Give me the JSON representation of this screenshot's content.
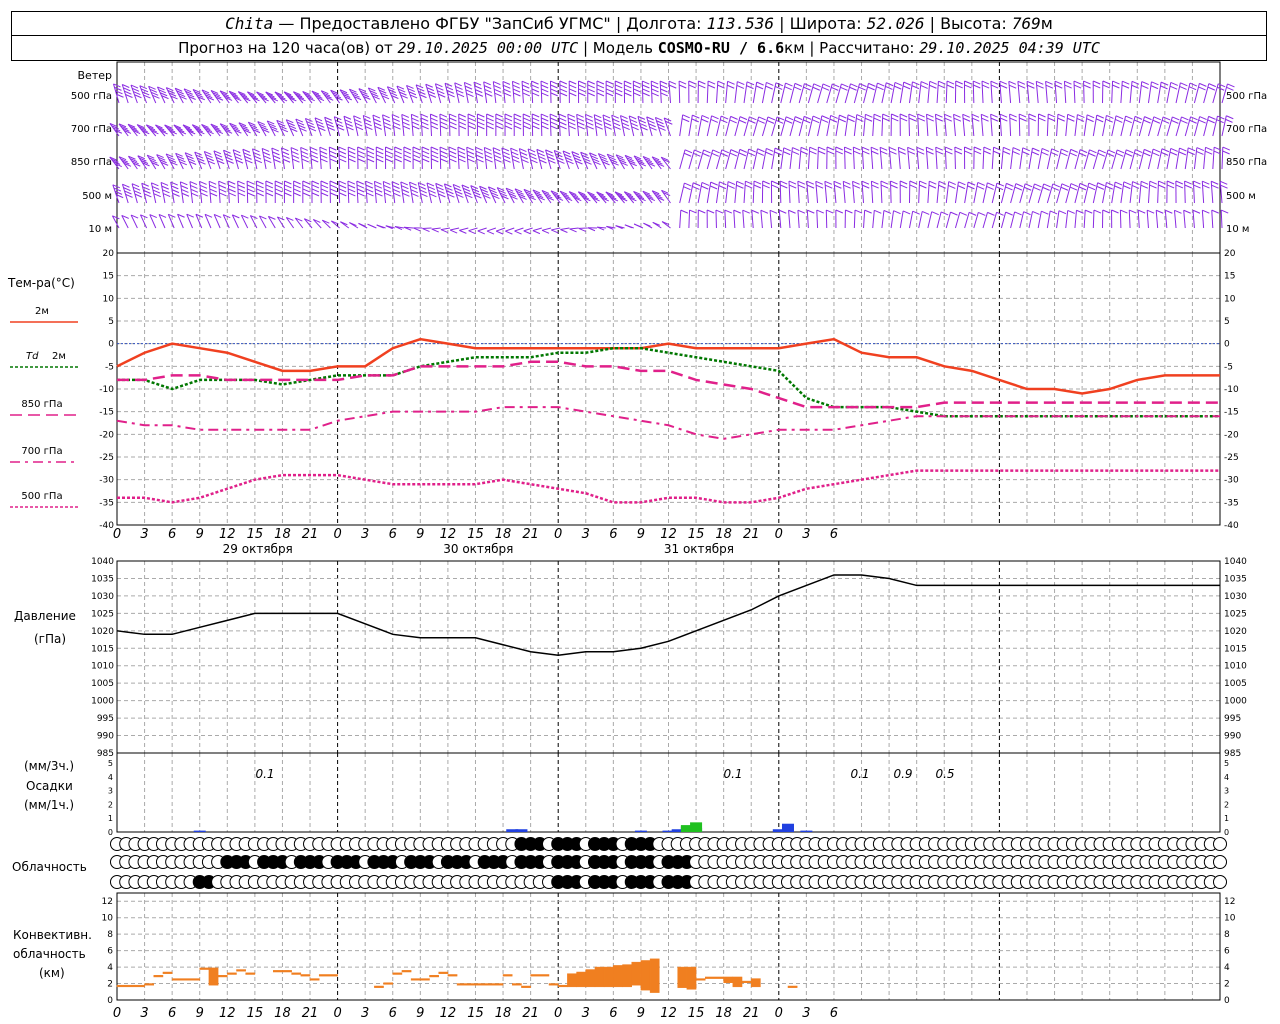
{
  "header": {
    "station": "Chita",
    "provider": "Предоставлено ФГБУ \"ЗапСиб УГМС\"",
    "lon_label": "Долгота:",
    "lon": "113.536",
    "lat_label": "Широта:",
    "lat": "52.026",
    "alt_label": "Высота:",
    "alt": "769",
    "alt_unit": "м",
    "forecast_label": "Прогноз на 120 часа(ов) от",
    "forecast_time": "29.10.2025 00:00 UTC",
    "model_label": "Модель",
    "model": "COSMO-RU / 6.6",
    "model_unit": "км",
    "computed_label": "Рассчитано:",
    "computed_time": "29.10.2025 04:39 UTC"
  },
  "colors": {
    "wind": "#8a2be2",
    "t2m": "#f04020",
    "td2m": "#007700",
    "t850": "#e0208a",
    "t700": "#e0208a",
    "t500": "#e0208a",
    "pressure": "#000000",
    "precip_blue": "#2040e0",
    "precip_green": "#20c020",
    "conv": "#f07f20",
    "zero_line": "#3050c0",
    "grid": "#aaaaaa"
  },
  "wind_panel": {
    "title": "Ветер",
    "levels": [
      "500 гПа",
      "700 гПа",
      "850 гПа",
      "500 м",
      "10  м"
    ],
    "right_levels": [
      "500 гПа",
      "700 гПа",
      "850 гПа",
      "500 м",
      "10  м"
    ]
  },
  "time_axis": {
    "ticks": [
      "0",
      "3",
      "6",
      "9",
      "12",
      "15",
      "18",
      "21",
      "0",
      "3",
      "6",
      "9",
      "12",
      "15",
      "18",
      "21",
      "0",
      "3",
      "6",
      "9",
      "12",
      "15",
      "18",
      "21",
      "0",
      "3",
      "6"
    ],
    "days": [
      "29 октября",
      "30 октября",
      "31 октября"
    ]
  },
  "temp_panel": {
    "title": "Тем-ра(°C)",
    "legend": [
      {
        "label": "2м"
      },
      {
        "label_prefix": "Td",
        "label": "2м"
      },
      {
        "label": "850 гПа"
      },
      {
        "label": "700 гПа"
      },
      {
        "label": "500 гПа"
      }
    ]
  },
  "pressure_panel": {
    "title": "Давление",
    "unit": "(гПа)"
  },
  "precip_panel": {
    "unit3": "(мм/3ч.)",
    "title": "Осадки",
    "unit1": "(мм/1ч.)",
    "labels": [
      "0.1",
      "0.1",
      "0.1",
      "0.9",
      "0.5"
    ]
  },
  "cloud_panel": {
    "title": "Облачность"
  },
  "conv_panel": {
    "title1": "Конвективн.",
    "title2": "облачность",
    "unit": "(км)"
  },
  "chart_data": [
    {
      "type": "line",
      "title": "Тем-ра(°C)",
      "x_hours": [
        0,
        3,
        6,
        9,
        12,
        15,
        18,
        21,
        24,
        27,
        30,
        33,
        36,
        39,
        42,
        45,
        48,
        51,
        54,
        57,
        60,
        63,
        66,
        69,
        72,
        75,
        78,
        81,
        84,
        87,
        90,
        93,
        96,
        99,
        102,
        105,
        108,
        111,
        114,
        117,
        120
      ],
      "ylim": [
        -40,
        20
      ],
      "yticks": [
        20,
        15,
        10,
        5,
        0,
        -5,
        -10,
        -15,
        -20,
        -25,
        -30,
        -35,
        -40
      ],
      "series": [
        {
          "name": "2м",
          "values": [
            -5,
            -2,
            0,
            -1,
            -2,
            -4,
            -6,
            -6,
            -5,
            -5,
            -1,
            1,
            0,
            -1,
            -1,
            -1,
            -1,
            -1,
            -1,
            -1,
            0,
            -1,
            -1,
            -1,
            -1,
            0,
            1,
            -2,
            -3,
            -3,
            -5,
            -6,
            -8,
            -10,
            -10,
            -11,
            -10,
            -8,
            -7,
            -7,
            -7
          ]
        },
        {
          "name": "Td 2м",
          "values": [
            -8,
            -8,
            -10,
            -8,
            -8,
            -8,
            -9,
            -8,
            -7,
            -7,
            -7,
            -5,
            -4,
            -3,
            -3,
            -3,
            -2,
            -2,
            -1,
            -1,
            -2,
            -3,
            -4,
            -5,
            -6,
            -12,
            -14,
            -14,
            -14,
            -15,
            -16,
            -16,
            -16,
            -16,
            -16,
            -16,
            -16,
            -16,
            -16,
            -16,
            -16
          ]
        },
        {
          "name": "850 гПа",
          "values": [
            -8,
            -8,
            -7,
            -7,
            -8,
            -8,
            -8,
            -8,
            -8,
            -7,
            -7,
            -5,
            -5,
            -5,
            -5,
            -4,
            -4,
            -5,
            -5,
            -6,
            -6,
            -8,
            -9,
            -10,
            -12,
            -14,
            -14,
            -14,
            -14,
            -14,
            -13,
            -13,
            -13,
            -13,
            -13,
            -13,
            -13,
            -13,
            -13,
            -13,
            -13
          ]
        },
        {
          "name": "700 гПа",
          "values": [
            -17,
            -18,
            -18,
            -19,
            -19,
            -19,
            -19,
            -19,
            -17,
            -16,
            -15,
            -15,
            -15,
            -15,
            -14,
            -14,
            -14,
            -15,
            -16,
            -17,
            -18,
            -20,
            -21,
            -20,
            -19,
            -19,
            -19,
            -18,
            -17,
            -16,
            -16,
            -16,
            -16,
            -16,
            -16,
            -16,
            -16,
            -16,
            -16,
            -16,
            -16
          ]
        },
        {
          "name": "500 гПа",
          "values": [
            -34,
            -34,
            -35,
            -34,
            -32,
            -30,
            -29,
            -29,
            -29,
            -30,
            -31,
            -31,
            -31,
            -31,
            -30,
            -31,
            -32,
            -33,
            -35,
            -35,
            -34,
            -34,
            -35,
            -35,
            -34,
            -32,
            -31,
            -30,
            -29,
            -28,
            -28,
            -28,
            -28,
            -28,
            -28,
            -28,
            -28,
            -28,
            -28,
            -28,
            -28
          ]
        }
      ]
    },
    {
      "type": "line",
      "title": "Давление",
      "ylabel": "(гПа)",
      "x_hours": [
        0,
        3,
        6,
        9,
        12,
        15,
        18,
        21,
        24,
        27,
        30,
        33,
        36,
        39,
        42,
        45,
        48,
        51,
        54,
        57,
        60,
        63,
        66,
        69,
        72,
        75,
        78,
        81,
        84,
        87,
        90,
        93,
        96,
        99,
        102,
        105,
        108,
        111,
        114,
        117,
        120
      ],
      "ylim": [
        985,
        1040
      ],
      "yticks": [
        1040,
        1035,
        1030,
        1025,
        1020,
        1015,
        1010,
        1005,
        1000,
        995,
        990,
        985
      ],
      "series": [
        {
          "name": "Давление",
          "values": [
            1020,
            1019,
            1019,
            1021,
            1023,
            1025,
            1025,
            1025,
            1025,
            1022,
            1019,
            1018,
            1018,
            1018,
            1016,
            1014,
            1013,
            1014,
            1014,
            1015,
            1017,
            1020,
            1023,
            1026,
            1030,
            1033,
            1036,
            1036,
            1035,
            1033,
            1033,
            1033,
            1033,
            1033,
            1033,
            1033,
            1033,
            1033,
            1033,
            1033,
            1033
          ]
        }
      ]
    },
    {
      "type": "bar",
      "title": "Осадки",
      "ylabel": "(мм/1ч.)",
      "ylim": [
        0,
        5
      ],
      "yticks": [
        5,
        4,
        3,
        2,
        1,
        0
      ],
      "series": [
        {
          "name": "blue",
          "x_hours": [
            9,
            43,
            44,
            57,
            60,
            61,
            62,
            63,
            72,
            73,
            75
          ],
          "values": [
            0.1,
            0.2,
            0.2,
            0.1,
            0.1,
            0.2,
            0.4,
            0.3,
            0.2,
            0.6,
            0.1
          ]
        },
        {
          "name": "green",
          "x_hours": [
            62,
            63
          ],
          "values": [
            0.5,
            0.7
          ]
        }
      ]
    },
    {
      "type": "bar",
      "title": "Конвективн. облачность",
      "ylabel": "(км)",
      "ylim": [
        0,
        13
      ],
      "yticks": [
        12,
        10,
        8,
        6,
        4,
        2,
        0
      ],
      "segments": [
        {
          "x0": 0,
          "x1": 3,
          "bottom": 1.6,
          "top": 1.8
        },
        {
          "x0": 3,
          "x1": 4,
          "bottom": 1.8,
          "top": 2
        },
        {
          "x0": 4,
          "x1": 5,
          "bottom": 2.8,
          "top": 3
        },
        {
          "x0": 5,
          "x1": 6,
          "bottom": 3.2,
          "top": 3.4
        },
        {
          "x0": 6,
          "x1": 9,
          "bottom": 2.4,
          "top": 2.6
        },
        {
          "x0": 9,
          "x1": 10,
          "bottom": 3.7,
          "top": 3.9
        },
        {
          "x0": 10,
          "x1": 11,
          "bottom": 1.8,
          "top": 3.9
        },
        {
          "x0": 11,
          "x1": 12,
          "bottom": 2.8,
          "top": 3
        },
        {
          "x0": 12,
          "x1": 13,
          "bottom": 3.1,
          "top": 3.3
        },
        {
          "x0": 13,
          "x1": 14,
          "bottom": 3.5,
          "top": 3.7
        },
        {
          "x0": 14,
          "x1": 15,
          "bottom": 3.1,
          "top": 3.3
        },
        {
          "x0": 17,
          "x1": 19,
          "bottom": 3.4,
          "top": 3.6
        },
        {
          "x0": 19,
          "x1": 20,
          "bottom": 3.1,
          "top": 3.3
        },
        {
          "x0": 20,
          "x1": 21,
          "bottom": 2.9,
          "top": 3.1
        },
        {
          "x0": 21,
          "x1": 22,
          "bottom": 2.4,
          "top": 2.6
        },
        {
          "x0": 22,
          "x1": 24,
          "bottom": 2.9,
          "top": 3.1
        },
        {
          "x0": 28,
          "x1": 29,
          "bottom": 1.5,
          "top": 1.7
        },
        {
          "x0": 29,
          "x1": 30,
          "bottom": 1.9,
          "top": 2.1
        },
        {
          "x0": 30,
          "x1": 31,
          "bottom": 3.1,
          "top": 3.3
        },
        {
          "x0": 31,
          "x1": 32,
          "bottom": 3.4,
          "top": 3.6
        },
        {
          "x0": 32,
          "x1": 34,
          "bottom": 2.4,
          "top": 2.6
        },
        {
          "x0": 34,
          "x1": 35,
          "bottom": 2.8,
          "top": 3
        },
        {
          "x0": 35,
          "x1": 36,
          "bottom": 3.2,
          "top": 3.4
        },
        {
          "x0": 36,
          "x1": 37,
          "bottom": 2.9,
          "top": 3.1
        },
        {
          "x0": 37,
          "x1": 42,
          "bottom": 1.8,
          "top": 2
        },
        {
          "x0": 42,
          "x1": 43,
          "bottom": 2.9,
          "top": 3.1
        },
        {
          "x0": 43,
          "x1": 44,
          "bottom": 1.8,
          "top": 2
        },
        {
          "x0": 44,
          "x1": 45,
          "bottom": 1.5,
          "top": 1.7
        },
        {
          "x0": 45,
          "x1": 47,
          "bottom": 2.9,
          "top": 3.1
        },
        {
          "x0": 47,
          "x1": 48,
          "bottom": 1.8,
          "top": 2
        },
        {
          "x0": 48,
          "x1": 49,
          "bottom": 1.6,
          "top": 1.8
        },
        {
          "x0": 49,
          "x1": 50,
          "bottom": 1.6,
          "top": 3.2
        },
        {
          "x0": 50,
          "x1": 51,
          "bottom": 1.6,
          "top": 3.4
        },
        {
          "x0": 51,
          "x1": 52,
          "bottom": 1.6,
          "top": 3.7
        },
        {
          "x0": 52,
          "x1": 53,
          "bottom": 1.6,
          "top": 4.0
        },
        {
          "x0": 53,
          "x1": 54,
          "bottom": 1.6,
          "top": 4.0
        },
        {
          "x0": 54,
          "x1": 55,
          "bottom": 1.6,
          "top": 4.2
        },
        {
          "x0": 55,
          "x1": 56,
          "bottom": 1.6,
          "top": 4.3
        },
        {
          "x0": 56,
          "x1": 57,
          "bottom": 1.8,
          "top": 4.6
        },
        {
          "x0": 57,
          "x1": 58,
          "bottom": 1.2,
          "top": 4.8
        },
        {
          "x0": 58,
          "x1": 59,
          "bottom": 0.9,
          "top": 5.0
        },
        {
          "x0": 61,
          "x1": 62,
          "bottom": 1.5,
          "top": 4.0
        },
        {
          "x0": 62,
          "x1": 63,
          "bottom": 1.3,
          "top": 4.0
        },
        {
          "x0": 63,
          "x1": 64,
          "bottom": 2.4,
          "top": 2.6
        },
        {
          "x0": 64,
          "x1": 66,
          "bottom": 2.6,
          "top": 2.8
        },
        {
          "x0": 66,
          "x1": 67,
          "bottom": 2.1,
          "top": 2.8
        },
        {
          "x0": 67,
          "x1": 68,
          "bottom": 1.6,
          "top": 2.8
        },
        {
          "x0": 68,
          "x1": 69,
          "bottom": 2.1,
          "top": 2.3
        },
        {
          "x0": 69,
          "x1": 70,
          "bottom": 1.6,
          "top": 2.6
        },
        {
          "x0": 73,
          "x1": 74,
          "bottom": 1.5,
          "top": 1.7
        }
      ]
    }
  ]
}
